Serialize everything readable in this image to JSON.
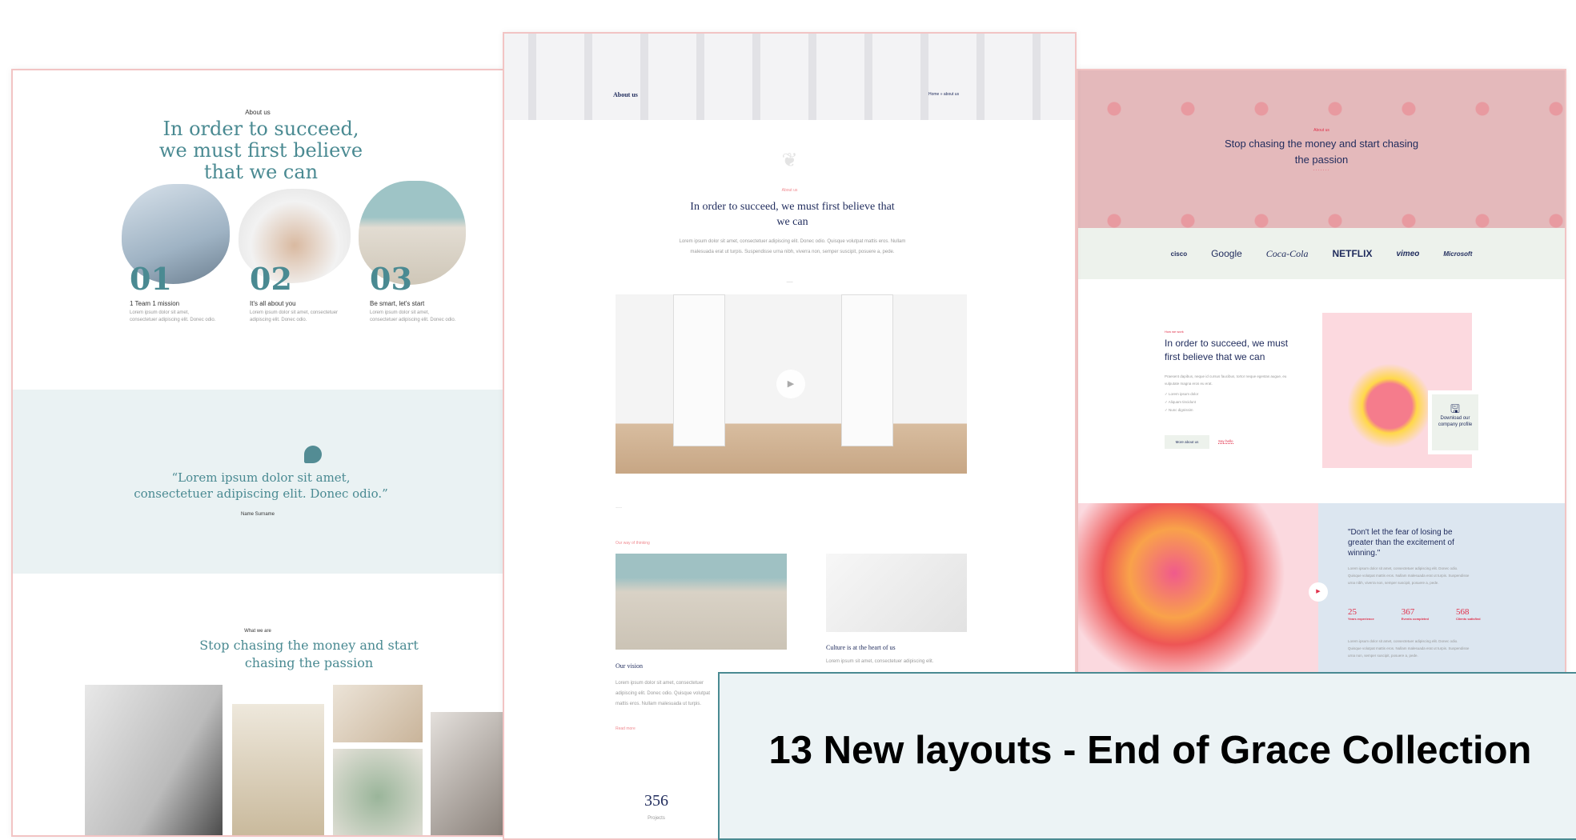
{
  "banner": {
    "title": "13 New layouts - End of Grace Collection"
  },
  "left": {
    "eyebrow": "About us",
    "heading": "In order to succeed, we must first believe that we can",
    "features": [
      {
        "num": "01",
        "title": "1 Team 1 mission",
        "desc": "Lorem ipsum dolor sit amet, consectetuer adipiscing elit. Donec odio."
      },
      {
        "num": "02",
        "title": "It's all about you",
        "desc": "Lorem ipsum dolor sit amet, consectetuer adipiscing elit. Donec odio."
      },
      {
        "num": "03",
        "title": "Be smart, let's start",
        "desc": "Lorem ipsum dolor sit amet, consectetuer adipiscing elit. Donec odio."
      }
    ],
    "quote": "“Lorem ipsum dolor sit amet, consectetuer adipiscing elit. Donec odio.”",
    "quote_author": "Name Surname",
    "eyebrow2": "What we are",
    "heading2": "Stop chasing the money and start chasing the passion"
  },
  "mid": {
    "page_title": "About us",
    "breadcrumb": {
      "home": "Home",
      "sep": "»",
      "current": "about us"
    },
    "eyebrow": "About us",
    "heading": "In order to succeed, we must first believe that we can",
    "body": "Lorem ipsum dolor sit amet, consectetuer adipiscing elit. Donec odio. Quisque volutpat mattis eros. Nullam malesuada erat ut turpis. Suspendisse urna nibh, viverra non, semper suscipit, posuere a, pede.",
    "section_eyebrow": "Our way of thinking",
    "vision_title": "Our vision",
    "vision_body": "Lorem ipsum dolor sit amet, consectetuer adipiscing elit. Donec odio. Quisque volutpat mattis eros. Nullam malesuada ut turpis.",
    "read_more": "Read more",
    "culture_title": "Culture is at the heart of us",
    "culture_body": "Lorem ipsum sit amet, consectetuer adipiscing elit.",
    "stat_value": "356",
    "stat_label": "Projects"
  },
  "right": {
    "hero_eyebrow": "About us",
    "hero_heading": "Stop chasing the money and start chasing the passion",
    "logos": [
      "cisco",
      "Google",
      "Coca-Cola",
      "NETFLIX",
      "vimeo",
      "Microsoft"
    ],
    "eyebrow": "How we work",
    "heading": "In order to succeed, we must first believe that we can",
    "body": "Praesent dapibus, neque id cursus faucibus, tortor neque egestas augue, eu vulputate magna eros eu erat.",
    "checklist": [
      "Lorem ipsum dolor",
      "Aliquam tincidunt",
      "Nunc dignissim"
    ],
    "btn_primary": "More about us",
    "btn_link": "Say hello",
    "download": "Download our company profile",
    "quote": "\"Don't let the fear of losing be greater than the excitement of winning.\"",
    "quote_body": "Lorem ipsum dolor sit amet, consectetuer adipiscing elit. Donec odio. Quisque volutpat mattis eros. Nullam malesuada erat ut turpis. Suspendisse urna nibh, viverra non, semper suscipit, posuere a, pede.",
    "stats": [
      {
        "value": "25",
        "label": "Years experience"
      },
      {
        "value": "367",
        "label": "Events completed"
      },
      {
        "value": "568",
        "label": "Clients satisfied"
      }
    ],
    "footer_body": "Lorem ipsum dolor sit amet, consectetuer adipiscing elit. Donec odio. Quisque volutpat mattis eros. Nullam malesuada erat ut turpis. Suspendisse urna non, semper suscipit, posuere a, pede."
  },
  "colors": {
    "teal": "#4a8a92",
    "navy": "#1f2b5c",
    "pink": "#f08a90",
    "red": "#e0304a",
    "hero_pink": "#e4b9bb",
    "mint": "#edf2ec",
    "ice": "#eaf2f3",
    "blue": "#dce6f0"
  }
}
